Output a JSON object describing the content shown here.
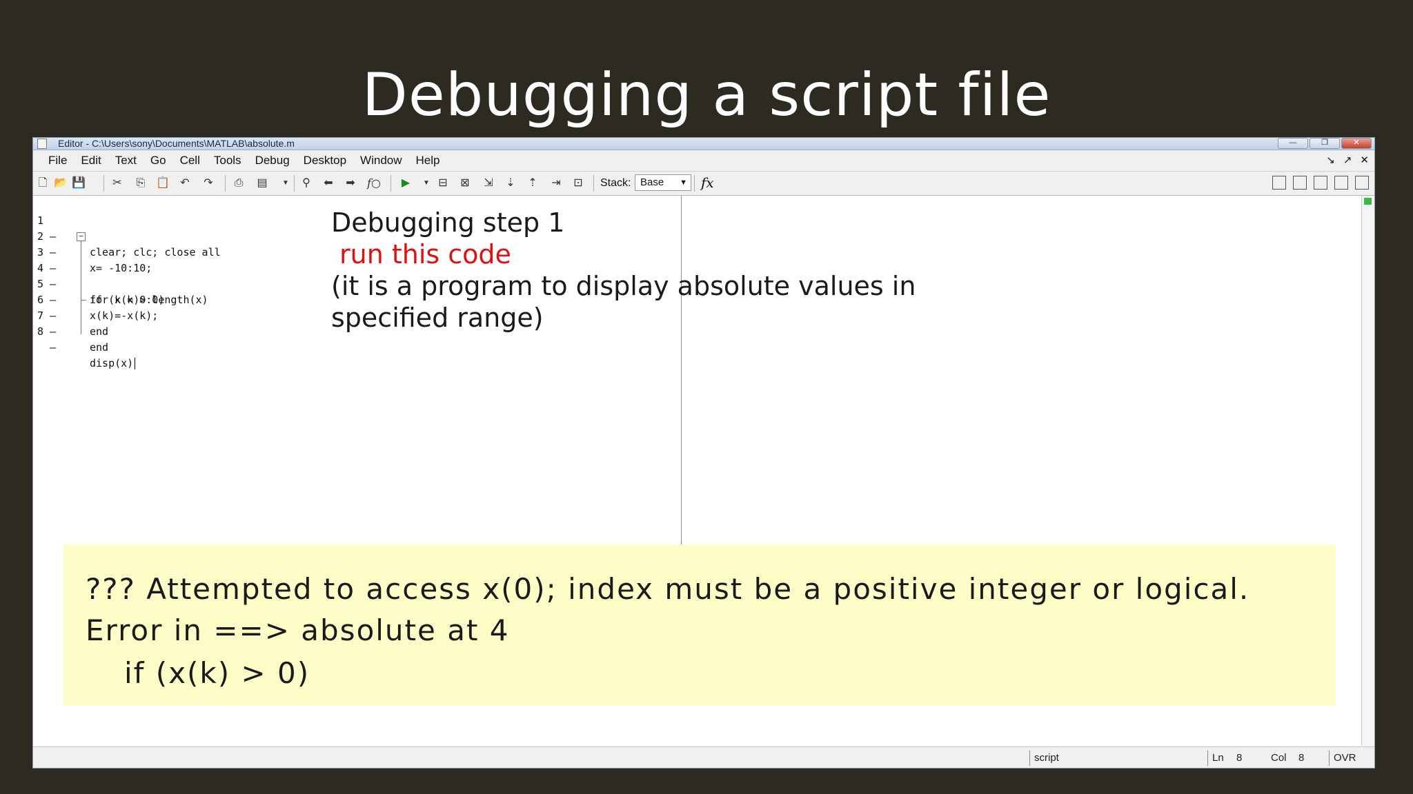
{
  "slide": {
    "title": "Debugging a script file"
  },
  "window": {
    "title": "Editor - C:\\Users\\sony\\Documents\\MATLAB\\absolute.m",
    "controls": [
      "—",
      "❐",
      "✕"
    ]
  },
  "menu": {
    "items": [
      "File",
      "Edit",
      "Text",
      "Go",
      "Cell",
      "Tools",
      "Debug",
      "Desktop",
      "Window",
      "Help"
    ],
    "right_icons": [
      "↘",
      "↗",
      "✕"
    ]
  },
  "toolbar": {
    "stack_label": "Stack:",
    "stack_value": "Base",
    "fx_label": "fx"
  },
  "code": {
    "lines": [
      {
        "num": "1",
        "text": "clear; clc; close all"
      },
      {
        "num": "2",
        "text": "x= -10:10;"
      },
      {
        "num": "3",
        "text": "for k = 0:length(x)"
      },
      {
        "num": "4",
        "text": "if (x(k)> 0)"
      },
      {
        "num": "5",
        "text": "x(k)=-x(k);"
      },
      {
        "num": "6",
        "text": "end"
      },
      {
        "num": "7",
        "text": "end"
      },
      {
        "num": "8",
        "text": "disp(x)"
      }
    ]
  },
  "note": {
    "heading": "Debugging step 1",
    "action": "run this code",
    "description_line1": "(it is a program to display absolute values in",
    "description_line2": "specified range)"
  },
  "error": {
    "line1": "??? Attempted to access x(0); index must be a positive integer or logical.",
    "line2": "Error in ==> absolute at 4",
    "line3": "if (x(k) > 0)"
  },
  "statusbar": {
    "mode": "script",
    "ln_label": "Ln",
    "ln_value": "8",
    "col_label": "Col",
    "col_value": "8",
    "ovr": "OVR"
  },
  "colors": {
    "slide_bg": "#2d2a22",
    "highlight_red": "#e01010",
    "error_bg": "#fdfdc8"
  }
}
